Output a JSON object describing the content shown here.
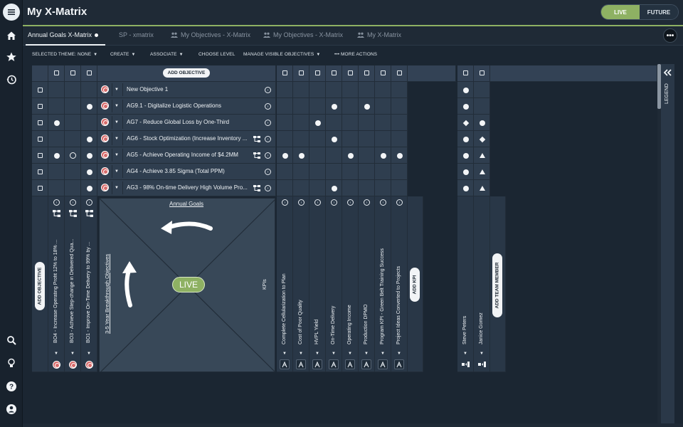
{
  "app": {
    "title": "My X-Matrix",
    "mode_live": "LIVE",
    "mode_future": "FUTURE"
  },
  "colors": {
    "accent_green": "#8eb163",
    "panel": "#2f3e4f",
    "background": "#1b2632",
    "target_red": "#d76a6a"
  },
  "tabs": [
    {
      "label": "Annual Goals X-Matrix",
      "active": true
    },
    {
      "label": "SP - xmatrix",
      "active": false
    },
    {
      "label": "My Objectives - X-Matrix",
      "active": false,
      "icon": "people-icon"
    },
    {
      "label": "My Objectives - X-Matrix",
      "active": false,
      "icon": "people-icon"
    },
    {
      "label": "My X-Matrix",
      "active": false,
      "icon": "people-icon"
    }
  ],
  "toolbar": {
    "selected_theme": "SELECTED THEME: NONE",
    "create": "CREATE",
    "associate": "ASSOCIATE",
    "choose_level": "CHOOSE LEVEL",
    "manage_visible": "MANAGE VISIBLE OBJECTIVES",
    "more_actions": "MORE ACTIONS"
  },
  "matrix": {
    "add_objective": "ADD OBJECTIVE",
    "add_kpi": "ADD KPI",
    "add_team_member": "ADD TEAM MEMBER",
    "center": {
      "top_label": "Annual Goals",
      "left_label": "3-5 Year Breakthrough Objectives",
      "right_label": "KPIs",
      "badge": "LIVE"
    },
    "annual_goals": [
      {
        "name": "New Objective 1"
      },
      {
        "name": "AG9.1 - Digitalize Logistic Operations"
      },
      {
        "name": "AG7 - Reduce Global Loss by One-Third"
      },
      {
        "name": "AG6 - Stock Optimization (Increase Inventory ..."
      },
      {
        "name": "AG5 - Achieve Operating Income of $4.2MM"
      },
      {
        "name": "AG4 - Achieve 3.85 Sigma (Total PPM)"
      },
      {
        "name": "AG3 - 98% On-time Delivery High Volume Pro..."
      }
    ],
    "breakthrough_objectives": [
      "BO4 - Increase Operating Profit 12% to 18% ...",
      "BO3 - Achieve Step-change in Delivered Qua...",
      "BO1 - Improve On-Time Delivery to 99% by ..."
    ],
    "kpis": [
      "Complete Cellularization to Plan",
      "Cost of Poor Quality",
      "HVPL Yield",
      "On-Time Delivery",
      "Operating Income",
      "Production DPMO",
      "Program KPI - Green Belt Training Success",
      "Project Ideas Converted to Projects"
    ],
    "team_members": [
      "Steve Peters",
      "Janice Gomez"
    ]
  },
  "legend": {
    "label": "LEGEND"
  }
}
